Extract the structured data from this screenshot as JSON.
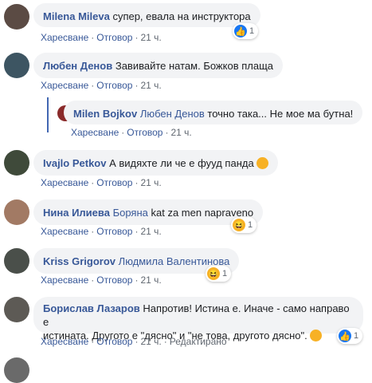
{
  "comments": [
    {
      "author": "Milena Mileva",
      "tag": "",
      "text": "супер, евала на инструктора",
      "actions": {
        "like": "Харесване",
        "reply": "Отговор",
        "time": "21 ч."
      },
      "reaction": {
        "type": "like",
        "count": "1"
      },
      "avatar_color": "#5b4b44"
    },
    {
      "author": "Любен Денов",
      "tag": "",
      "text": "Завивайте натам. Божков плаща",
      "actions": {
        "like": "Харесване",
        "reply": "Отговор",
        "time": "21 ч."
      },
      "avatar_color": "#3d5562"
    },
    {
      "author": "Milen Bojkov",
      "tag": "Любен Денов",
      "text": "точно така... Не мое ма бутна!",
      "actions": {
        "like": "Харесване",
        "reply": "Отговор",
        "time": "21 ч."
      },
      "avatar_color": "#8a2a2a"
    },
    {
      "author": "Ivajlo Petkov",
      "tag": "",
      "text": "А видяхте ли че е фууд панда",
      "actions": {
        "like": "Харесване",
        "reply": "Отговор",
        "time": "21 ч."
      },
      "avatar_color": "#3f4a3a"
    },
    {
      "author": "Нина Илиева",
      "tag": "Боряна",
      "text": "kat za men napraveno",
      "actions": {
        "like": "Харесване",
        "reply": "Отговор",
        "time": "21 ч."
      },
      "reaction": {
        "type": "haha",
        "count": "1"
      },
      "avatar_color": "#a27a64"
    },
    {
      "author": "Kriss Grigorov",
      "tag": "Людмила Валентинова",
      "text": "",
      "actions": {
        "like": "Харесване",
        "reply": "Отговор",
        "time": "21 ч."
      },
      "reaction": {
        "type": "haha",
        "count": "1"
      },
      "avatar_color": "#4a4f4a"
    },
    {
      "author": "Борислав Лазаров",
      "tag": "",
      "text_line1": "Напротив! Истина е. Иначе - само направо е",
      "text_line2": "истината. Другото е \"дясно\" и \"не това, другото дясно\".",
      "actions": {
        "like": "Харесване",
        "reply": "Отговор",
        "time": "21 ч.",
        "edited": "Редактирано"
      },
      "reaction": {
        "type": "like",
        "count": "1"
      },
      "avatar_color": "#5d5a55"
    }
  ],
  "colors": {
    "link": "#385898",
    "bubble": "#f2f3f5",
    "meta": "#606770",
    "like": "#1877f2",
    "haha": "#f7b125"
  },
  "icons": {
    "like": "thumbs-up-icon",
    "haha": "laughing-emoji-icon"
  }
}
